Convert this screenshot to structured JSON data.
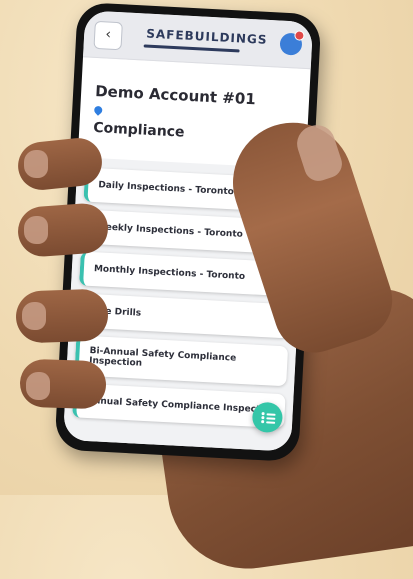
{
  "app": {
    "logo_text": "SAFEBUILDINGS",
    "back_icon": "chevron-left-icon",
    "back_glyph": "‹",
    "avatar_icon": "user-avatar-icon"
  },
  "account": {
    "title": "Demo Account #01",
    "section": "Compliance"
  },
  "inspections": [
    {
      "label": "Daily Inspections - Toronto"
    },
    {
      "label": "Weekly Inspections - Toronto"
    },
    {
      "label": "Monthly Inspections - Toronto"
    },
    {
      "label": "Fire Drills"
    },
    {
      "label": "Bi-Annual Safety Compliance Inspection"
    },
    {
      "label": "Annual Safety Compliance Inspection"
    }
  ],
  "colors": {
    "accent": "#3ac1b0",
    "fab": "#34c6a8",
    "avatar": "#3b7ed8",
    "background": "#efd9b0"
  },
  "fab": {
    "icon": "menu-list-icon"
  }
}
